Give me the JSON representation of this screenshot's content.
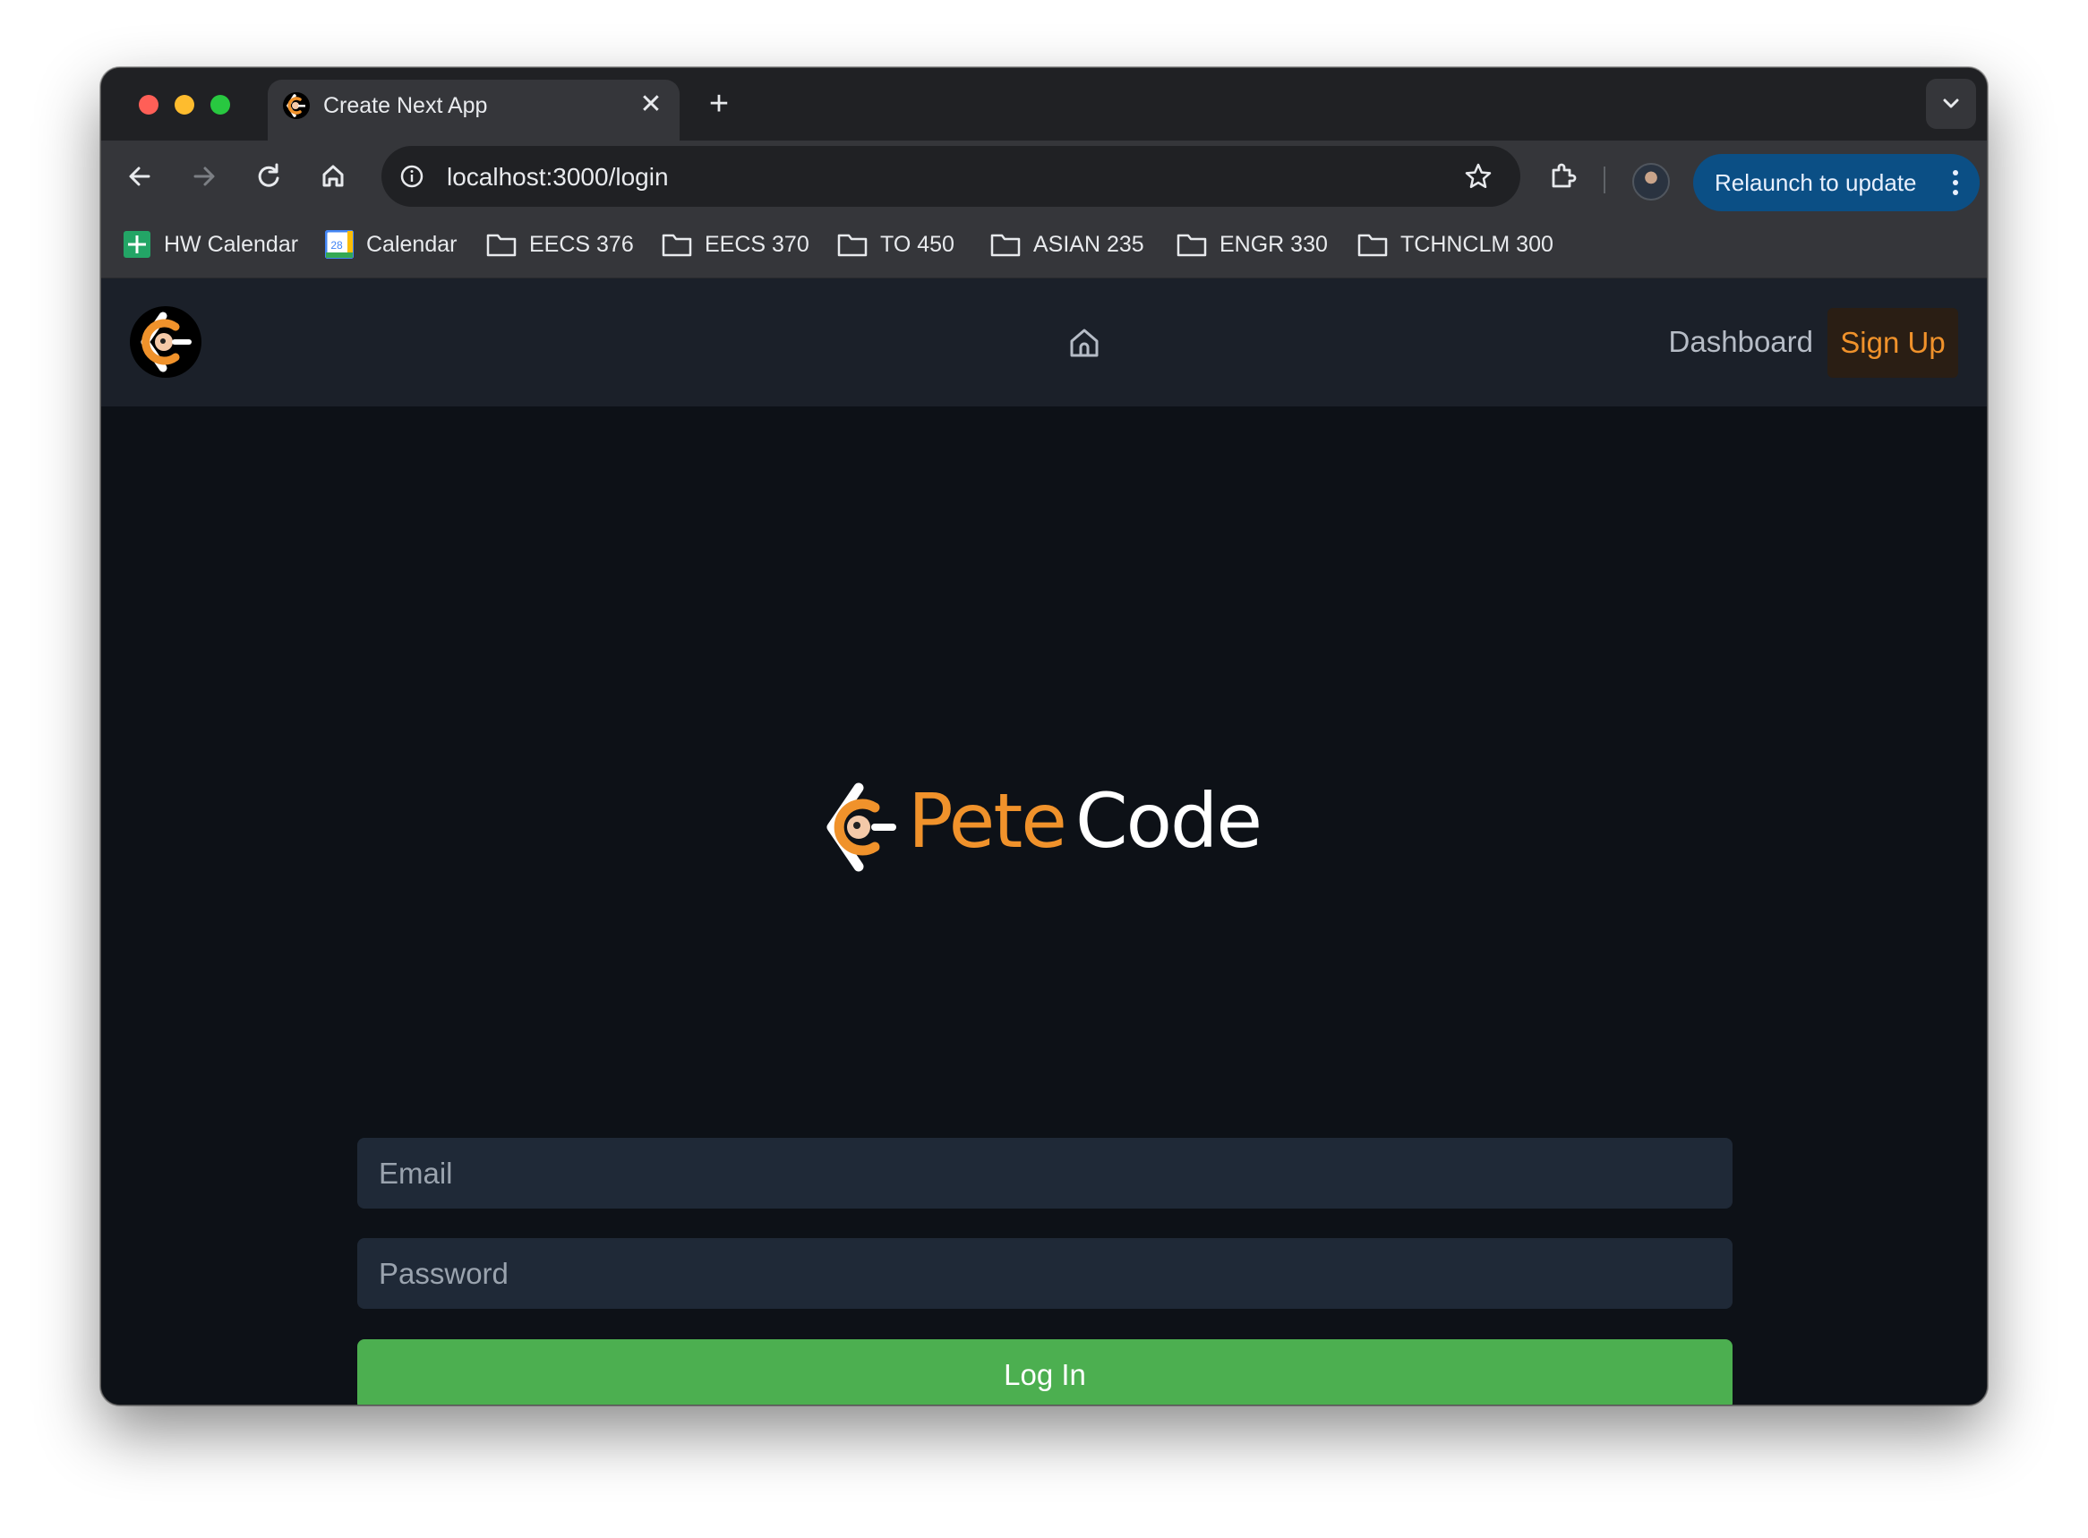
{
  "browser": {
    "tab": {
      "title": "Create Next App",
      "close": "✕"
    },
    "new_tab": "+",
    "address": {
      "url": "localhost:3000/login"
    },
    "relaunch_label": "Relaunch to update",
    "bookmarks": [
      {
        "label": "HW Calendar",
        "icon": "sheets-icon"
      },
      {
        "label": "Calendar",
        "icon": "calendar-icon",
        "icon_text": "28"
      },
      {
        "label": "EECS 376",
        "icon": "folder-icon"
      },
      {
        "label": "EECS 370",
        "icon": "folder-icon"
      },
      {
        "label": "TO 450",
        "icon": "folder-icon"
      },
      {
        "label": "ASIAN 235",
        "icon": "folder-icon"
      },
      {
        "label": "ENGR 330",
        "icon": "folder-icon"
      },
      {
        "label": "TCHNCLM 300",
        "icon": "folder-icon"
      }
    ]
  },
  "nav": {
    "dashboard": "Dashboard",
    "signup": "Sign Up"
  },
  "brand": {
    "word1": "Pete",
    "word2": "Code",
    "accent_color": "#f0922b"
  },
  "form": {
    "email_placeholder": "Email",
    "password_placeholder": "Password",
    "submit_label": "Log In",
    "submit_color": "#4caf50"
  }
}
